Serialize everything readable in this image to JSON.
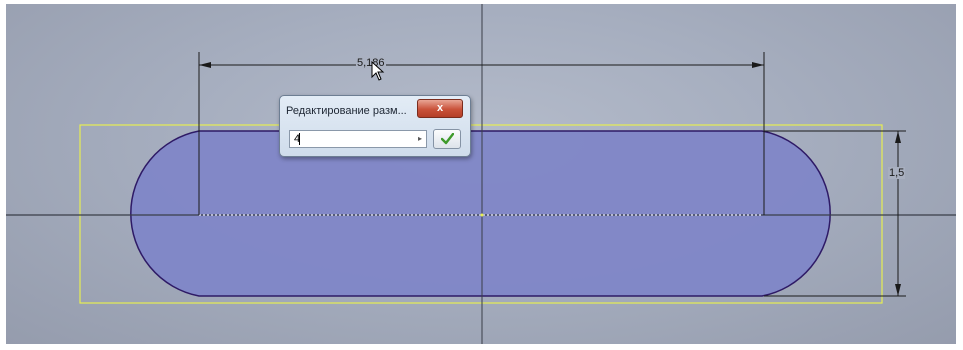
{
  "sketch": {
    "dimension_horizontal": "5,186",
    "dimension_vertical": "1,5"
  },
  "dialog": {
    "title": "Редактирование разм...",
    "close_label": "x",
    "input_value": "4",
    "input_arrow": "▸",
    "ok_label": "✔"
  },
  "colors": {
    "slot_fill": "#7f86c7",
    "slot_outline": "#2e1a66",
    "selection_box": "#e7ee52",
    "dim_line": "#1a1a1a",
    "axis_line": "#3a3e48",
    "ok_check": "#3e9a2b",
    "close_button": "#c9523a"
  },
  "icons": {
    "close": "close-icon",
    "ok": "checkmark-icon",
    "dropdown": "arrow-right-icon",
    "cursor": "mouse-pointer-icon"
  }
}
